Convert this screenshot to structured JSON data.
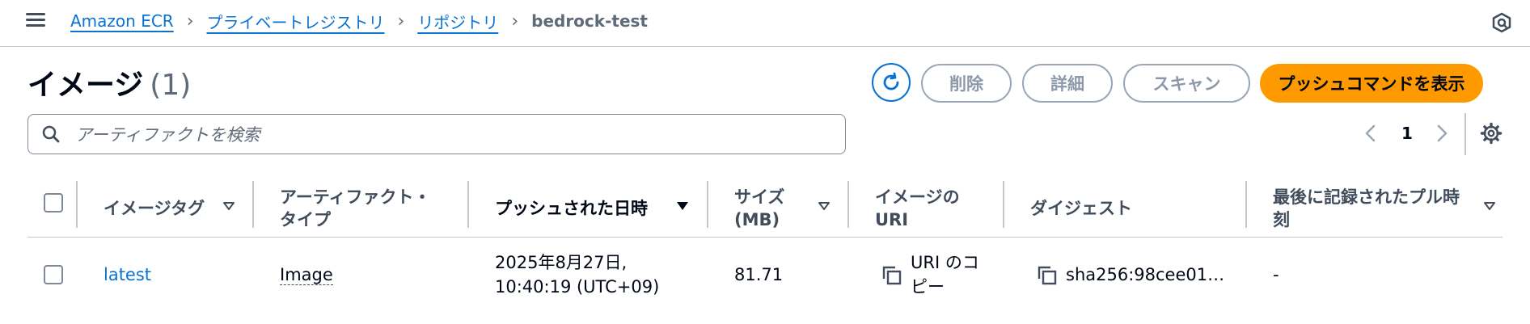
{
  "breadcrumb": {
    "items": [
      "Amazon ECR",
      "プライベートレジストリ",
      "リポジトリ"
    ],
    "current": "bedrock-test"
  },
  "header": {
    "title": "イメージ",
    "count": "(1)",
    "buttons": {
      "delete": "削除",
      "details": "詳細",
      "scan": "スキャン",
      "push": "プッシュコマンドを表示"
    }
  },
  "search": {
    "placeholder": "アーティファクトを検索"
  },
  "pagination": {
    "current_page": "1"
  },
  "table": {
    "columns": {
      "tag": "イメージタグ",
      "type_line1": "アーティファクト・",
      "type_line2": "タイプ",
      "pushed": "プッシュされた日時",
      "size_line1": "サイズ",
      "size_line2": "(MB)",
      "uri_line1": "イメージの",
      "uri_line2": "URI",
      "digest": "ダイジェスト",
      "pulled_line1": "最後に記録されたプル時",
      "pulled_line2": "刻"
    },
    "rows": [
      {
        "tag": "latest",
        "type": "Image",
        "pushed_line1": "2025年8月27日,",
        "pushed_line2": "10:40:19 (UTC+09)",
        "size": "81.71",
        "uri_copy_line1": "URI のコ",
        "uri_copy_line2": "ピー",
        "digest": "sha256:98cee01…",
        "last_pull": "-"
      }
    ]
  },
  "colors": {
    "link": "#0972d3",
    "primary": "#ff9900",
    "border": "#c6c6cd",
    "text": "#000716",
    "disabled": "#8d99a8"
  },
  "icons": [
    "menu-icon",
    "chevron-right-icon",
    "help-icon",
    "refresh-icon",
    "search-icon",
    "chevron-left-icon",
    "settings-icon",
    "caret-down-icon",
    "copy-icon"
  ]
}
